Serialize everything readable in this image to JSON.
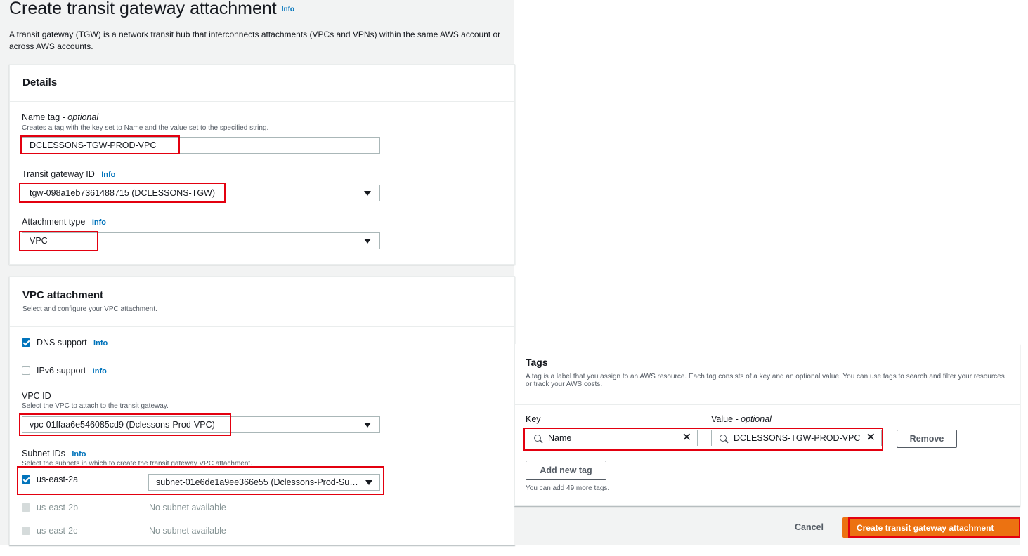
{
  "page": {
    "title": "Create transit gateway attachment",
    "title_info": "Info",
    "description": "A transit gateway (TGW) is a network transit hub that interconnects attachments (VPCs and VPNs) within the same AWS account or across AWS accounts."
  },
  "details": {
    "heading": "Details",
    "name_tag": {
      "label": "Name tag",
      "label_optional": " - optional",
      "description": "Creates a tag with the key set to Name and the value set to the specified string.",
      "value": "DCLESSONS-TGW-PROD-VPC"
    },
    "transit_gateway_id": {
      "label": "Transit gateway ID",
      "info": "Info",
      "value": "tgw-098a1eb7361488715 (DCLESSONS-TGW)"
    },
    "attachment_type": {
      "label": "Attachment type",
      "info": "Info",
      "value": "VPC"
    }
  },
  "vpc_attachment": {
    "heading": "VPC attachment",
    "description": "Select and configure your VPC attachment.",
    "dns_support": {
      "label": "DNS support",
      "info": "Info",
      "checked": true
    },
    "ipv6_support": {
      "label": "IPv6 support",
      "info": "Info",
      "checked": false
    },
    "vpc_id": {
      "label": "VPC ID",
      "description": "Select the VPC to attach to the transit gateway.",
      "value": "vpc-01ffaa6e546085cd9 (Dclessons-Prod-VPC)"
    },
    "subnet_ids": {
      "label": "Subnet IDs",
      "info": "Info",
      "description": "Select the subnets in which to create the transit gateway VPC attachment.",
      "rows": [
        {
          "az": "us-east-2a",
          "checked": true,
          "value": "subnet-01e6de1a9ee366e55 (Dclessons-Prod-Su…"
        },
        {
          "az": "us-east-2b",
          "checked": false,
          "value": "No subnet available"
        },
        {
          "az": "us-east-2c",
          "checked": false,
          "value": "No subnet available"
        }
      ]
    }
  },
  "tags": {
    "heading": "Tags",
    "description": "A tag is a label that you assign to an AWS resource. Each tag consists of a key and an optional value. You can use tags to search and filter your resources or track your AWS costs.",
    "key_label": "Key",
    "value_label": "Value",
    "value_optional": " - optional",
    "row": {
      "key": "Name",
      "value": "DCLESSONS-TGW-PROD-VPC"
    },
    "remove_label": "Remove",
    "add_tag_label": "Add new tag",
    "remaining_text": "You can add 49 more tags."
  },
  "footer": {
    "cancel_label": "Cancel",
    "submit_label": "Create transit gateway attachment"
  },
  "colors": {
    "primary_button": "#ec7211",
    "highlight": "#e3000f",
    "link": "#0073bb",
    "checkbox": "#0073bb"
  }
}
